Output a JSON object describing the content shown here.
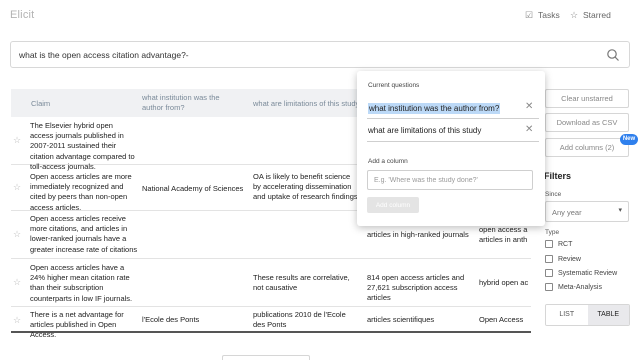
{
  "app": {
    "title": "Elicit"
  },
  "nav": {
    "tasks_label": "Tasks",
    "tasks_icon": "checklist-icon",
    "starred_label": "Starred",
    "starred_icon": "star-outline-icon"
  },
  "search": {
    "query": "what is the open access citation advantage?-",
    "icon": "search-icon"
  },
  "table": {
    "headers": {
      "claim": "Claim",
      "institution": "what institution was the author from?",
      "limitations": "what are limitations of this study",
      "col4": "",
      "col5": ""
    },
    "rows": [
      {
        "claim": "The Elsevier hybrid open access journals published in 2007-2011 sustained their citation advantage compared to toll-access journals.",
        "institution": "",
        "limitations": "",
        "col4": "",
        "col5": ""
      },
      {
        "claim": "Open access articles are more immediately recognized and cited by peers than non-open access articles.",
        "institution": "National Academy of Sciences",
        "limitations": "OA is likely to benefit science by accelerating dissemination and uptake of research findings",
        "col4": "",
        "col5": ""
      },
      {
        "claim": "Open access articles receive more citations, and articles in lower-ranked journals have a greater increase rate of citations if they ar...",
        "institution": "",
        "limitations": "",
        "col4": "articles in high-ranked journals",
        "col5": "open access a articles in anth"
      },
      {
        "claim": "Open access articles have a 24% higher mean citation rate than their subscription counterparts in low IF journals.",
        "institution": "",
        "limitations": "These results are correlative, not causative",
        "col4": "814 open access articles and 27,621 subscription access articles",
        "col5": "hybrid open ac"
      },
      {
        "claim": "There is a net advantage for articles published in Open Access.",
        "institution": "l'Ecole des Ponts",
        "limitations": "publications 2010 de l'Ecole des Ponts",
        "col4": "articles scientifiques",
        "col5": "Open Access"
      }
    ]
  },
  "sidebar": {
    "clear_unstarred": "Clear unstarred",
    "download_csv": "Download as CSV",
    "add_columns": "Add columns (2)",
    "new_badge": "New",
    "filters_title": "Filters",
    "since_label": "Since",
    "year_value": "Any year",
    "type_label": "Type",
    "types": [
      "RCT",
      "Review",
      "Systematic Review",
      "Meta-Analysis"
    ],
    "view_list": "LIST",
    "view_table": "TABLE"
  },
  "popup": {
    "title": "Current questions",
    "questions": [
      "what institution was the author from?",
      "what are limitations of this study"
    ],
    "add_label": "Add a column",
    "add_placeholder": "E.g. 'Where was the study done?'",
    "add_button": "Add column"
  },
  "colors": {
    "accent": "#2f80ed",
    "highlight": "#bcd9f7",
    "header_bg": "#f0f1f3"
  }
}
